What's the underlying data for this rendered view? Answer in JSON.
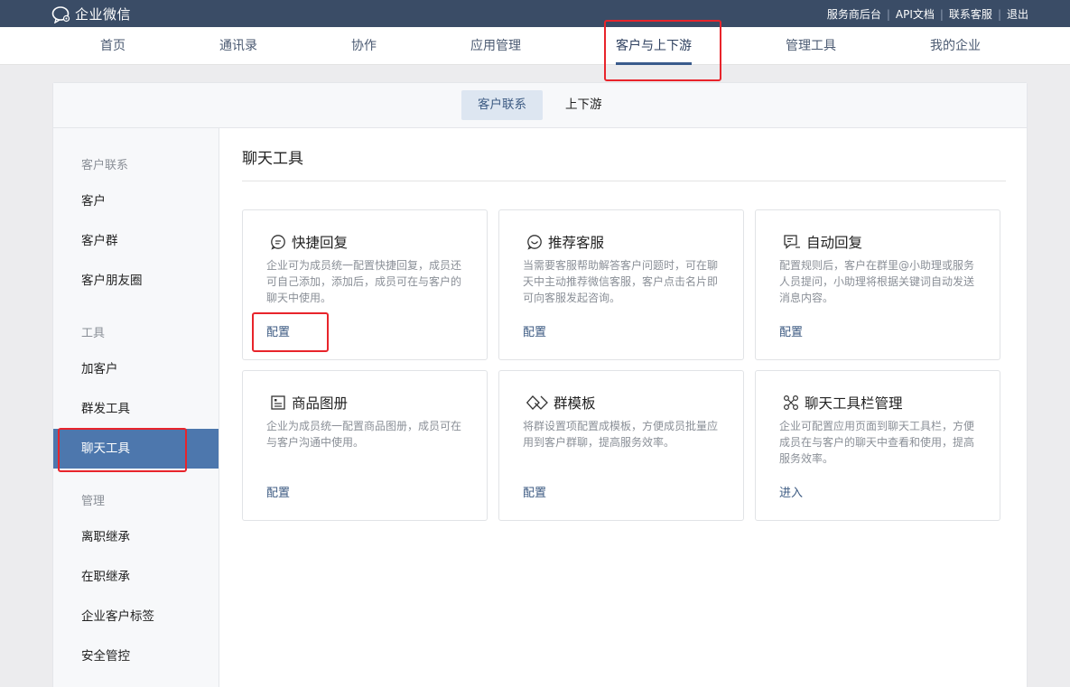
{
  "header": {
    "brand": "企业微信",
    "links": [
      "服务商后台",
      "API文档",
      "联系客服",
      "退出"
    ]
  },
  "nav": {
    "items": [
      "首页",
      "通讯录",
      "协作",
      "应用管理",
      "客户与上下游",
      "管理工具",
      "我的企业"
    ],
    "active": "客户与上下游"
  },
  "subtabs": {
    "items": [
      "客户联系",
      "上下游"
    ],
    "active": "客户联系"
  },
  "sidebar": {
    "groups": [
      {
        "label": "客户联系",
        "items": [
          "客户",
          "客户群",
          "客户朋友圈"
        ]
      },
      {
        "label": "工具",
        "items": [
          "加客户",
          "群发工具",
          "聊天工具"
        ]
      },
      {
        "label": "管理",
        "items": [
          "离职继承",
          "在职继承",
          "企业客户标签",
          "安全管控"
        ]
      }
    ],
    "active": "聊天工具"
  },
  "main": {
    "title": "聊天工具",
    "cards": [
      {
        "icon": "quick-reply-icon",
        "title": "快捷回复",
        "desc": "企业可为成员统一配置快捷回复，成员还可自己添加，添加后，成员可在与客户的聊天中使用。",
        "action": "配置"
      },
      {
        "icon": "recommend-service-icon",
        "title": "推荐客服",
        "desc": "当需要客服帮助解答客户问题时，可在聊天中主动推荐微信客服，客户点击名片即可向客服发起咨询。",
        "action": "配置"
      },
      {
        "icon": "auto-reply-icon",
        "title": "自动回复",
        "desc": "配置规则后，客户在群里@小助理或服务人员提问，小助理将根据关键词自动发送消息内容。",
        "action": "配置"
      },
      {
        "icon": "product-album-icon",
        "title": "商品图册",
        "desc": "企业为成员统一配置商品图册，成员可在与客户沟通中使用。",
        "action": "配置"
      },
      {
        "icon": "group-template-icon",
        "title": "群模板",
        "desc": "将群设置项配置成模板，方便成员批量应用到客户群聊，提高服务效率。",
        "action": "配置"
      },
      {
        "icon": "toolbar-manage-icon",
        "title": "聊天工具栏管理",
        "desc": "企业可配置应用页面到聊天工具栏，方便成员在与客户的聊天中查看和使用，提高服务效率。",
        "action": "进入"
      }
    ]
  },
  "colors": {
    "topbar": "#3a4c66",
    "sidebar_active": "#4d77ad",
    "link": "#3c5a82",
    "highlight": "#e8242b"
  }
}
